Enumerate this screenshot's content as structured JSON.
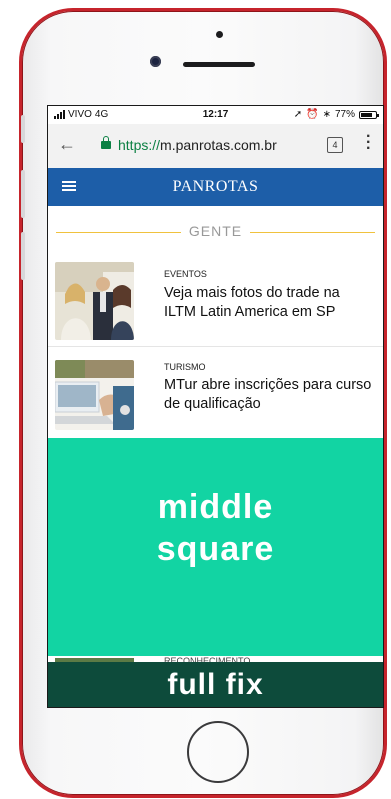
{
  "status_bar": {
    "carrier": "VIVO",
    "network": "4G",
    "time": "12:17",
    "battery": "77%",
    "battery_level": 0.77
  },
  "browser": {
    "url_scheme": "https://",
    "url_host": "m.panrotas.com.br",
    "tab_count": "4",
    "back_icon": "arrow-left-icon",
    "menu_icon": "more-vertical-icon"
  },
  "site": {
    "logo": "PANROTAS",
    "header_color": "#1d5ea8"
  },
  "section": {
    "title": "GENTE",
    "accent_color": "#f0c23e"
  },
  "articles": [
    {
      "category": "EVENTOS",
      "headline": "Veja mais fotos do trade na ILTM Latin America em SP"
    },
    {
      "category": "TURISMO",
      "headline": "MTur abre inscrições para curso de qualificação"
    },
    {
      "category": "RECONHECIMENTO"
    }
  ],
  "overlays": {
    "middle": {
      "line1": "middle",
      "line2": "square",
      "color": "#12d4a3"
    },
    "bottom": {
      "label": "full fix",
      "color": "#0d4b3b"
    }
  },
  "device": {
    "frame_color": "#c6242c"
  }
}
